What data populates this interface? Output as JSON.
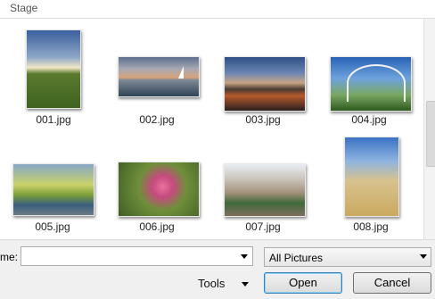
{
  "breadcrumb": "Stage",
  "thumbnails": [
    {
      "name": "001.jpg"
    },
    {
      "name": "002.jpg"
    },
    {
      "name": "003.jpg"
    },
    {
      "name": "004.jpg"
    },
    {
      "name": "005.jpg"
    },
    {
      "name": "006.jpg"
    },
    {
      "name": "007.jpg"
    },
    {
      "name": "008.jpg"
    }
  ],
  "filename": {
    "label": "me:",
    "value": ""
  },
  "filter": {
    "selected": "All Pictures"
  },
  "buttons": {
    "tools": "Tools",
    "open": "Open",
    "cancel": "Cancel"
  }
}
